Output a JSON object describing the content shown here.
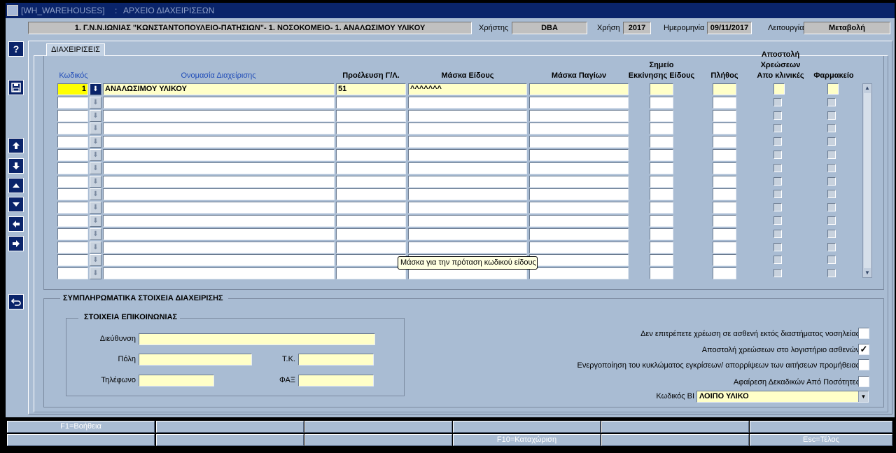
{
  "window": {
    "title": "[WH_WAREHOUSES]",
    "separator": ":",
    "subtitle": "ΑΡΧΕΙΟ ΔΙΑΧΕΙΡΙΣΕΩΝ"
  },
  "header": {
    "org": "1. Γ.Ν.Ν.ΙΩΝΙΑΣ \"ΚΩΝΣΤΑΝΤΟΠΟΥΛΕΙΟ-ΠΑΤΗΣΙΩΝ\"- 1. ΝΟΣΟΚΟΜΕΙΟ- 1. ΑΝΑΛΩΣΙΜΟΥ ΥΛΙΚΟΥ",
    "user_label": "Χρήστης",
    "user_value": "DBA",
    "year_label": "Χρήση",
    "year_value": "2017",
    "date_label": "Ημερομηνία",
    "date_value": "09/11/2017",
    "mode_label": "Λειτουργία",
    "mode_value": "Μεταβολή"
  },
  "toolbar": {
    "help": "?",
    "save": "save-icon",
    "first": "up-arrow-icon",
    "last": "down-arrow-icon",
    "prev": "up-triangle-icon",
    "next": "down-triangle-icon",
    "left": "left-arrow-icon",
    "right": "right-arrow-icon",
    "back": "return-icon"
  },
  "tab": {
    "label": "ΔΙΑΧΕΙΡΙΣΕΙΣ"
  },
  "grid": {
    "headers": {
      "code": "Κωδικός",
      "name": "Ονομασία Διαχείρισης",
      "origin": "Προέλευση Γ/Λ.",
      "item_mask": "Μάσκα Είδους",
      "asset_mask": "Μάσκα Παγίων",
      "start_point_1": "Σημείο",
      "start_point_2": "Εκκίνησης Είδους",
      "count": "Πλήθος",
      "send_1": "Αποστολή",
      "send_2": "Χρεώσεων",
      "send_3": "Απο κλινικές",
      "pharmacy": "Φαρμακείο"
    },
    "rows": [
      {
        "code": "1",
        "name": "ΑΝΑΛΩΣΙΜΟΥ ΥΛΙΚΟΥ",
        "origin": "51",
        "item_mask": "^^^^^^^",
        "asset_mask": "",
        "start": "",
        "count": ""
      },
      {
        "code": "",
        "name": "",
        "origin": "",
        "item_mask": "",
        "asset_mask": "",
        "start": "",
        "count": ""
      },
      {
        "code": "",
        "name": "",
        "origin": "",
        "item_mask": "",
        "asset_mask": "",
        "start": "",
        "count": ""
      },
      {
        "code": "",
        "name": "",
        "origin": "",
        "item_mask": "",
        "asset_mask": "",
        "start": "",
        "count": ""
      },
      {
        "code": "",
        "name": "",
        "origin": "",
        "item_mask": "",
        "asset_mask": "",
        "start": "",
        "count": ""
      },
      {
        "code": "",
        "name": "",
        "origin": "",
        "item_mask": "",
        "asset_mask": "",
        "start": "",
        "count": ""
      },
      {
        "code": "",
        "name": "",
        "origin": "",
        "item_mask": "",
        "asset_mask": "",
        "start": "",
        "count": ""
      },
      {
        "code": "",
        "name": "",
        "origin": "",
        "item_mask": "",
        "asset_mask": "",
        "start": "",
        "count": ""
      },
      {
        "code": "",
        "name": "",
        "origin": "",
        "item_mask": "",
        "asset_mask": "",
        "start": "",
        "count": ""
      },
      {
        "code": "",
        "name": "",
        "origin": "",
        "item_mask": "",
        "asset_mask": "",
        "start": "",
        "count": ""
      },
      {
        "code": "",
        "name": "",
        "origin": "",
        "item_mask": "",
        "asset_mask": "",
        "start": "",
        "count": ""
      },
      {
        "code": "",
        "name": "",
        "origin": "",
        "item_mask": "",
        "asset_mask": "",
        "start": "",
        "count": ""
      },
      {
        "code": "",
        "name": "",
        "origin": "",
        "item_mask": "",
        "asset_mask": "",
        "start": "",
        "count": ""
      },
      {
        "code": "",
        "name": "",
        "origin": "",
        "item_mask": "",
        "asset_mask": "",
        "start": "",
        "count": ""
      },
      {
        "code": "",
        "name": "",
        "origin": "",
        "item_mask": "",
        "asset_mask": "",
        "start": "",
        "count": ""
      }
    ],
    "tooltip": "Μάσκα για την πρόταση κωδικού είδους"
  },
  "details": {
    "title": "ΣΥΜΠΛΗΡΩΜΑΤΙΚΑ ΣΤΟΙΧΕΙΑ ΔΙΑΧΕΙΡΙΣΗΣ",
    "contact": {
      "title": "ΣΤΟΙΧΕΙΑ ΕΠΙΚΟΙΝΩΝΙΑΣ",
      "address_label": "Διεύθυνση",
      "city_label": "Πόλη",
      "zip_label": "Τ.Κ.",
      "phone_label": "Τηλέφωνο",
      "fax_label": "ΦΑΞ"
    },
    "options": [
      {
        "label": "Δεν επιτρέπετε χρέωση σε ασθενή εκτός διαστήματος νοσηλείας",
        "checked": ""
      },
      {
        "label": "Αποστολή χρεώσεων στο λογιστήριο ασθενών",
        "checked": "✓"
      },
      {
        "label": "Ενεργοποίηση του κυκλώματος εγκρίσεων/ απορρίψεων των αιτήσεων προμήθειας",
        "checked": ""
      },
      {
        "label": "Αφαίρεση Δεκαδικών Από Ποσότητες",
        "checked": ""
      }
    ],
    "bi_label": "Κωδικός BI",
    "bi_value": "ΛΟΙΠΟ ΥΛΙΚΟ"
  },
  "fkeys": {
    "row1": [
      "F1=Βοήθεια",
      "",
      "",
      "",
      "",
      ""
    ],
    "row2": [
      "",
      "",
      "",
      "F10=Καταχώριση",
      "",
      "Esc=Τέλος"
    ]
  }
}
